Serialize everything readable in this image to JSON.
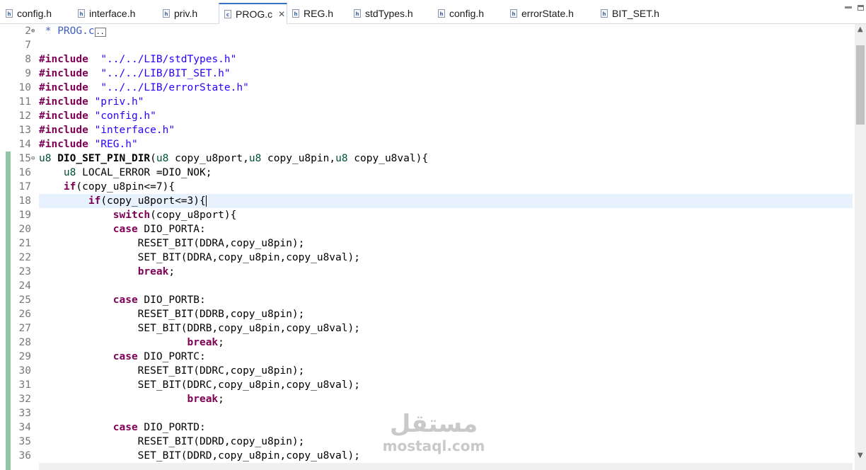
{
  "tabs": [
    {
      "label": "config.h",
      "icon": "h-file-icon",
      "active": false
    },
    {
      "label": "interface.h",
      "icon": "h-file-icon",
      "active": false
    },
    {
      "label": "priv.h",
      "icon": "h-file-icon",
      "active": false
    },
    {
      "label": "PROG.c",
      "icon": "c-file-icon",
      "active": true,
      "close": "✕"
    },
    {
      "label": "REG.h",
      "icon": "h-file-icon",
      "active": false
    },
    {
      "label": "stdTypes.h",
      "icon": "h-file-icon",
      "active": false
    },
    {
      "label": "config.h",
      "icon": "h-file-icon",
      "active": false
    },
    {
      "label": "errorState.h",
      "icon": "h-file-icon",
      "active": false
    },
    {
      "label": "BIT_SET.h",
      "icon": "h-file-icon",
      "active": false
    }
  ],
  "editor": {
    "current_line": 18,
    "lines": [
      {
        "n": "2",
        "fold": "⊕",
        "tokens": [
          {
            "t": " * PROG.c",
            "c": "cm"
          },
          {
            "t": "..",
            "c": "box"
          }
        ]
      },
      {
        "n": "7",
        "tokens": []
      },
      {
        "n": "8",
        "tokens": [
          {
            "t": "#include",
            "c": "kw"
          },
          {
            "t": "  "
          },
          {
            "t": "\"../../LIB/stdTypes.h\"",
            "c": "str"
          }
        ]
      },
      {
        "n": "9",
        "tokens": [
          {
            "t": "#include",
            "c": "kw"
          },
          {
            "t": "  "
          },
          {
            "t": "\"../../LIB/BIT_SET.h\"",
            "c": "str"
          }
        ]
      },
      {
        "n": "10",
        "tokens": [
          {
            "t": "#include",
            "c": "kw"
          },
          {
            "t": "  "
          },
          {
            "t": "\"../../LIB/errorState.h\"",
            "c": "str"
          }
        ]
      },
      {
        "n": "11",
        "tokens": [
          {
            "t": "#include",
            "c": "kw"
          },
          {
            "t": " "
          },
          {
            "t": "\"priv.h\"",
            "c": "str"
          }
        ]
      },
      {
        "n": "12",
        "tokens": [
          {
            "t": "#include",
            "c": "kw"
          },
          {
            "t": " "
          },
          {
            "t": "\"config.h\"",
            "c": "str"
          }
        ]
      },
      {
        "n": "13",
        "tokens": [
          {
            "t": "#include",
            "c": "kw"
          },
          {
            "t": " "
          },
          {
            "t": "\"interface.h\"",
            "c": "str"
          }
        ]
      },
      {
        "n": "14",
        "tokens": [
          {
            "t": "#include",
            "c": "kw"
          },
          {
            "t": " "
          },
          {
            "t": "\"REG.h\"",
            "c": "str"
          }
        ]
      },
      {
        "n": "15",
        "fold": "⊖",
        "tokens": [
          {
            "t": "u8",
            "c": "type"
          },
          {
            "t": " "
          },
          {
            "t": "DIO_SET_PIN_DIR",
            "c": "fn"
          },
          {
            "t": "("
          },
          {
            "t": "u8",
            "c": "type"
          },
          {
            "t": " copy_u8port,"
          },
          {
            "t": "u8",
            "c": "type"
          },
          {
            "t": " copy_u8pin,"
          },
          {
            "t": "u8",
            "c": "type"
          },
          {
            "t": " copy_u8val){"
          }
        ]
      },
      {
        "n": "16",
        "tokens": [
          {
            "t": "    "
          },
          {
            "t": "u8",
            "c": "type"
          },
          {
            "t": " LOCAL_ERROR =DIO_NOK;"
          }
        ]
      },
      {
        "n": "17",
        "tokens": [
          {
            "t": "    "
          },
          {
            "t": "if",
            "c": "kw"
          },
          {
            "t": "(copy_u8pin<=7){"
          }
        ]
      },
      {
        "n": "18",
        "tokens": [
          {
            "t": "        "
          },
          {
            "t": "if",
            "c": "kw"
          },
          {
            "t": "(copy_u8port<=3){"
          },
          {
            "t": "",
            "c": "caret"
          }
        ]
      },
      {
        "n": "19",
        "tokens": [
          {
            "t": "            "
          },
          {
            "t": "switch",
            "c": "kw"
          },
          {
            "t": "(copy_u8port){"
          }
        ]
      },
      {
        "n": "20",
        "tokens": [
          {
            "t": "            "
          },
          {
            "t": "case",
            "c": "kw"
          },
          {
            "t": " DIO_PORTA:"
          }
        ]
      },
      {
        "n": "21",
        "tokens": [
          {
            "t": "                RESET_BIT(DDRA,copy_u8pin);"
          }
        ]
      },
      {
        "n": "22",
        "tokens": [
          {
            "t": "                SET_BIT(DDRA,copy_u8pin,copy_u8val);"
          }
        ]
      },
      {
        "n": "23",
        "tokens": [
          {
            "t": "                "
          },
          {
            "t": "break",
            "c": "kw"
          },
          {
            "t": ";"
          }
        ]
      },
      {
        "n": "24",
        "tokens": []
      },
      {
        "n": "25",
        "tokens": [
          {
            "t": "            "
          },
          {
            "t": "case",
            "c": "kw"
          },
          {
            "t": " DIO_PORTB:"
          }
        ]
      },
      {
        "n": "26",
        "tokens": [
          {
            "t": "                RESET_BIT(DDRB,copy_u8pin);"
          }
        ]
      },
      {
        "n": "27",
        "tokens": [
          {
            "t": "                SET_BIT(DDRB,copy_u8pin,copy_u8val);"
          }
        ]
      },
      {
        "n": "28",
        "tokens": [
          {
            "t": "                        "
          },
          {
            "t": "break",
            "c": "kw"
          },
          {
            "t": ";"
          }
        ]
      },
      {
        "n": "29",
        "tokens": [
          {
            "t": "            "
          },
          {
            "t": "case",
            "c": "kw"
          },
          {
            "t": " DIO_PORTC:"
          }
        ]
      },
      {
        "n": "30",
        "tokens": [
          {
            "t": "                RESET_BIT(DDRC,copy_u8pin);"
          }
        ]
      },
      {
        "n": "31",
        "tokens": [
          {
            "t": "                SET_BIT(DDRC,copy_u8pin,copy_u8val);"
          }
        ]
      },
      {
        "n": "32",
        "tokens": [
          {
            "t": "                        "
          },
          {
            "t": "break",
            "c": "kw"
          },
          {
            "t": ";"
          }
        ]
      },
      {
        "n": "33",
        "tokens": []
      },
      {
        "n": "34",
        "tokens": [
          {
            "t": "            "
          },
          {
            "t": "case",
            "c": "kw"
          },
          {
            "t": " DIO_PORTD:"
          }
        ]
      },
      {
        "n": "35",
        "tokens": [
          {
            "t": "                RESET_BIT(DDRD,copy_u8pin);"
          }
        ]
      },
      {
        "n": "36",
        "tokens": [
          {
            "t": "                SET_BIT(DDRD,copy_u8pin,copy_u8val);"
          }
        ]
      }
    ]
  },
  "watermark": {
    "arabic": "مستقل",
    "latin": "mostaql.com"
  },
  "colors": {
    "keyword": "#7f0055",
    "string": "#2a00ff",
    "type": "#005032",
    "comment": "#3f5fbf",
    "current_line": "#e8f2fe",
    "accent": "#3873c2"
  }
}
